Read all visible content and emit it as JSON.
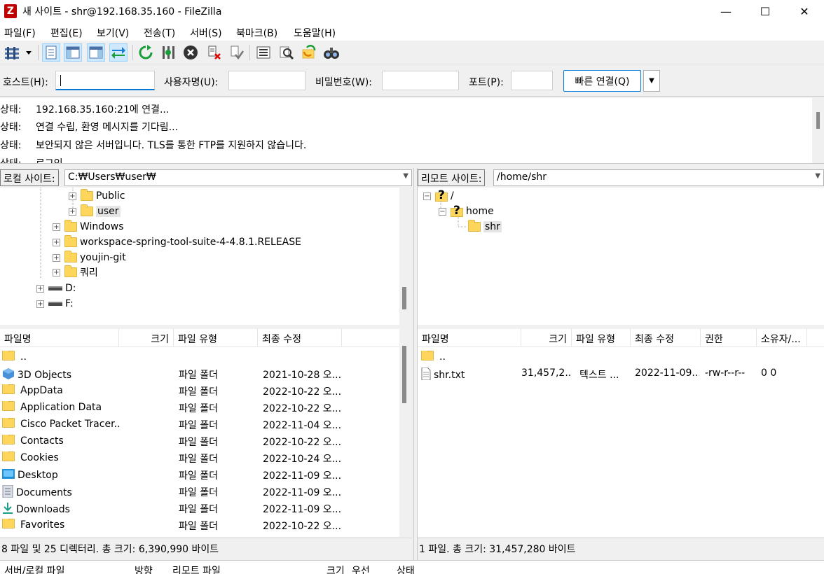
{
  "window": {
    "title": "새 사이트 - shr@192.168.35.160 - FileZilla",
    "app_icon": "Z",
    "minimize": "—",
    "maximize": "☐",
    "close": "✕"
  },
  "menu": [
    "파일(F)",
    "편집(E)",
    "보기(V)",
    "전송(T)",
    "서버(S)",
    "북마크(B)",
    "도움말(H)"
  ],
  "quickconnect": {
    "host_label": "호스트(H):",
    "host_value": "",
    "user_label": "사용자명(U):",
    "user_value": "",
    "pass_label": "비밀번호(W):",
    "pass_value": "",
    "port_label": "포트(P):",
    "port_value": "",
    "connect_label": "빠른 연결(Q)"
  },
  "log": [
    {
      "label": "상태:",
      "message": "192.168.35.160:21에 연결..."
    },
    {
      "label": "상태:",
      "message": "연결 수립, 환영 메시지를 기다림..."
    },
    {
      "label": "상태:",
      "message": "보안되지 않은 서버입니다. TLS를 통한 FTP를 지원하지 않습니다."
    },
    {
      "label": "상태:",
      "message": "로그인"
    }
  ],
  "local": {
    "site_label": "로컬 사이트:",
    "path": "C:₩Users₩user₩",
    "tree": [
      {
        "label": "Public",
        "type": "folder"
      },
      {
        "label": "user",
        "type": "folder"
      },
      {
        "label": "Windows",
        "type": "folder"
      },
      {
        "label": "workspace-spring-tool-suite-4-4.8.1.RELEASE",
        "type": "folder"
      },
      {
        "label": "youjin-git",
        "type": "folder"
      },
      {
        "label": "쿼리",
        "type": "folder"
      },
      {
        "label": "D:",
        "type": "drive"
      },
      {
        "label": "F:",
        "type": "drive"
      }
    ],
    "columns": [
      "파일명",
      "크기",
      "파일 유형",
      "최종 수정"
    ],
    "files": [
      {
        "name": "..",
        "size": "",
        "type": "",
        "modified": ""
      },
      {
        "name": "3D Objects",
        "size": "",
        "type": "파일 폴더",
        "modified": "2021-10-28 오..."
      },
      {
        "name": "AppData",
        "size": "",
        "type": "파일 폴더",
        "modified": "2022-10-22 오..."
      },
      {
        "name": "Application Data",
        "size": "",
        "type": "파일 폴더",
        "modified": "2022-10-22 오..."
      },
      {
        "name": "Cisco Packet Tracer...",
        "size": "",
        "type": "파일 폴더",
        "modified": "2022-11-04 오..."
      },
      {
        "name": "Contacts",
        "size": "",
        "type": "파일 폴더",
        "modified": "2022-10-22 오..."
      },
      {
        "name": "Cookies",
        "size": "",
        "type": "파일 폴더",
        "modified": "2022-10-24 오..."
      },
      {
        "name": "Desktop",
        "size": "",
        "type": "파일 폴더",
        "modified": "2022-11-09 오..."
      },
      {
        "name": "Documents",
        "size": "",
        "type": "파일 폴더",
        "modified": "2022-11-09 오..."
      },
      {
        "name": "Downloads",
        "size": "",
        "type": "파일 폴더",
        "modified": "2022-11-09 오..."
      },
      {
        "name": "Favorites",
        "size": "",
        "type": "파일 폴더",
        "modified": "2022-10-22 오..."
      }
    ],
    "status": "8 파일 및 25 디렉터리. 총 크기: 6,390,990 바이트"
  },
  "remote": {
    "site_label": "리모트 사이트:",
    "path": "/home/shr",
    "tree": [
      {
        "label": "/",
        "type": "unknown"
      },
      {
        "label": "home",
        "type": "unknown"
      },
      {
        "label": "shr",
        "type": "folder"
      }
    ],
    "columns": [
      "파일명",
      "크기",
      "파일 유형",
      "최종 수정",
      "권한",
      "소유자/..."
    ],
    "files": [
      {
        "name": "..",
        "size": "",
        "type": "",
        "modified": "",
        "perm": "",
        "owner": ""
      },
      {
        "name": "shr.txt",
        "size": "31,457,2...",
        "type": "텍스트 ...",
        "modified": "2022-11-09...",
        "perm": "-rw-r--r--",
        "owner": "0 0"
      }
    ],
    "status": "1 파일. 총 크기: 31,457,280 바이트"
  },
  "queue": {
    "columns": [
      "서버/로컬 파일",
      "방향",
      "리모트 파일",
      "크기",
      "우선",
      "상태"
    ]
  },
  "icons": {
    "toolbar": [
      "site-manager-icon",
      "toggle-log-icon",
      "toggle-local-tree-icon",
      "toggle-remote-tree-icon",
      "transfer-queue-icon",
      "refresh-icon",
      "process-queue-icon",
      "cancel-icon",
      "disconnect-icon",
      "reconnect-icon",
      "directory-listing-icon",
      "filter-icon",
      "sync-browse-icon",
      "search-icon"
    ]
  },
  "colors": {
    "accent": "#0078d7",
    "folder": "#ffd65c",
    "cancel": "#333333",
    "refresh": "#1a9e3a"
  }
}
